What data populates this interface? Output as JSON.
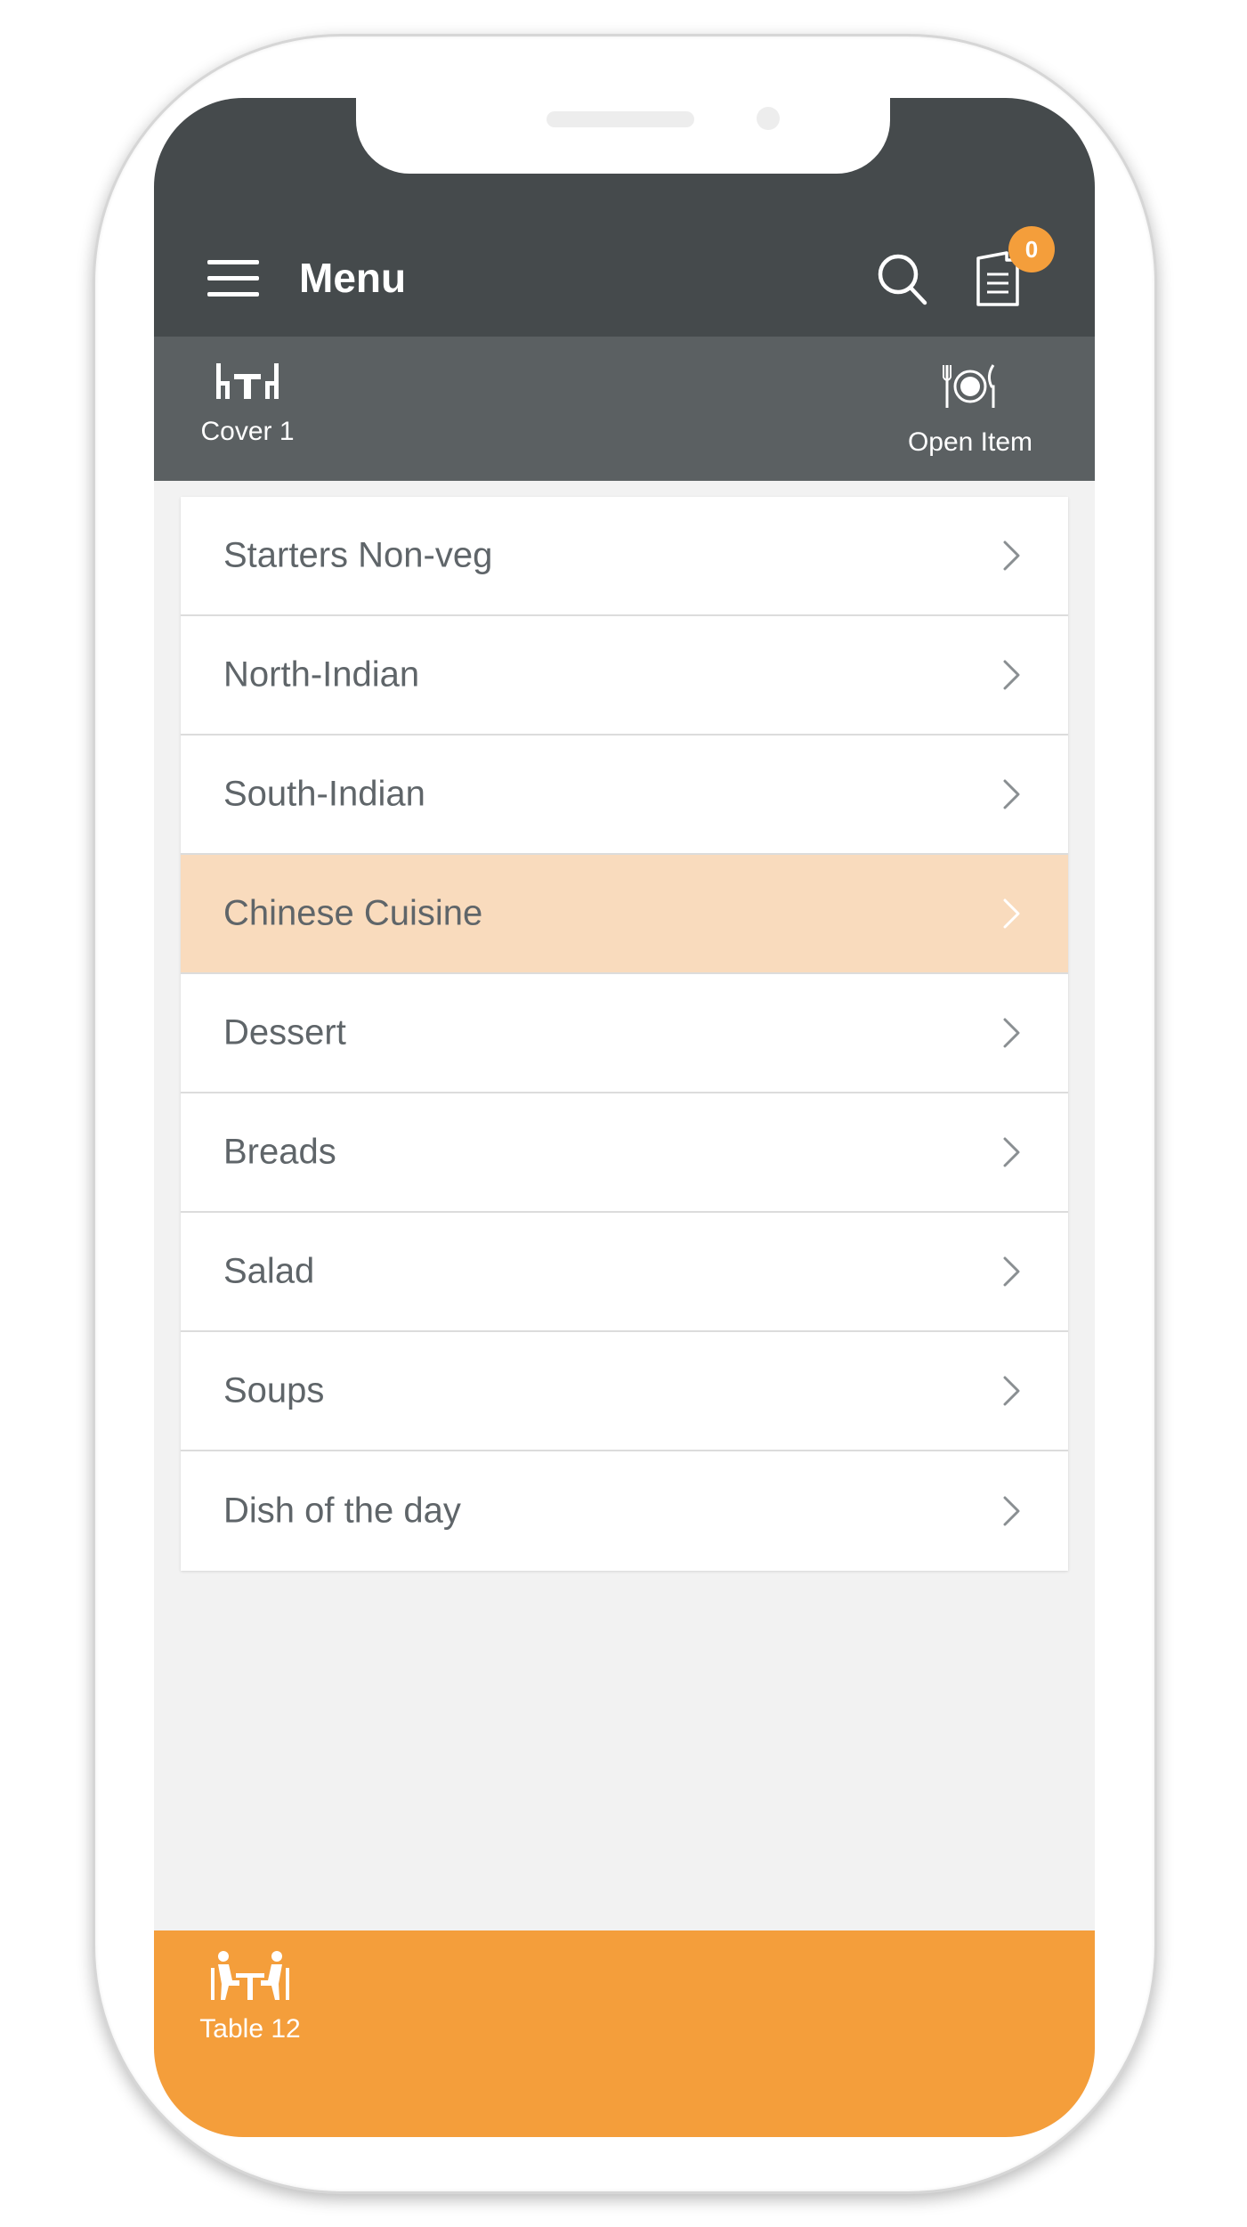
{
  "header": {
    "title": "Menu",
    "order_badge_count": "0"
  },
  "subheader": {
    "cover_label": "Cover 1",
    "open_item_label": "Open Item"
  },
  "menu": {
    "items": [
      {
        "label": "Starters Non-veg",
        "highlighted": false
      },
      {
        "label": "North-Indian",
        "highlighted": false
      },
      {
        "label": "South-Indian",
        "highlighted": false
      },
      {
        "label": "Chinese Cuisine",
        "highlighted": true
      },
      {
        "label": "Dessert",
        "highlighted": false
      },
      {
        "label": "Breads",
        "highlighted": false
      },
      {
        "label": "Salad",
        "highlighted": false
      },
      {
        "label": "Soups",
        "highlighted": false
      },
      {
        "label": "Dish of the day",
        "highlighted": false
      }
    ]
  },
  "footer": {
    "table_label": "Table 12"
  },
  "colors": {
    "header_bg": "#454a4c",
    "subheader_bg": "#5b6062",
    "accent": "#f49e3b",
    "highlight_row": "#f9dbbd",
    "item_text": "#5f6569"
  },
  "icons": {
    "menu": "hamburger-icon",
    "search": "search-icon",
    "order": "order-list-icon",
    "cover": "table-cover-icon",
    "open_item": "plate-cutlery-icon",
    "table": "dining-table-icon",
    "row_arrow": "chevron-right-icon"
  }
}
